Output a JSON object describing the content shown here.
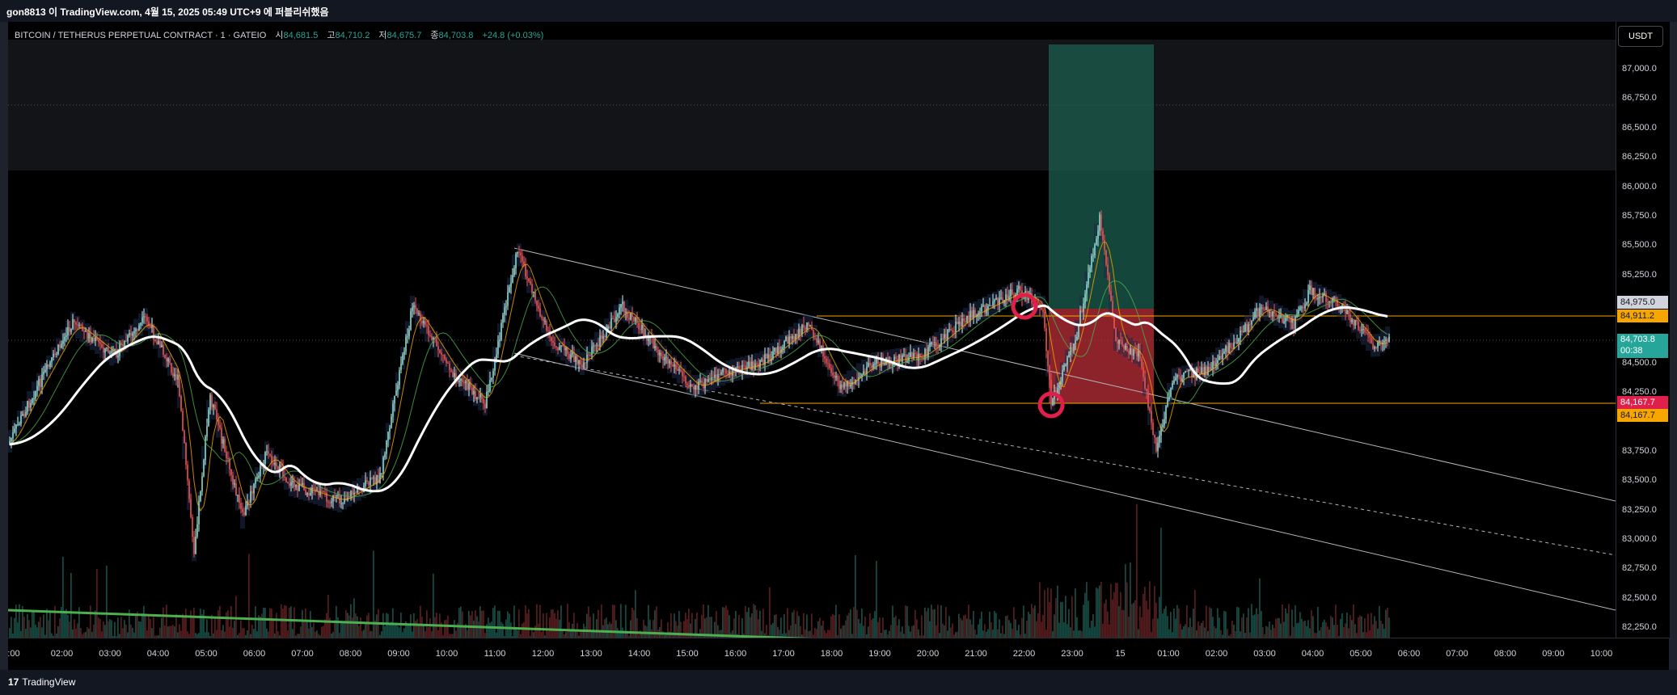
{
  "header": {
    "publish_text": "gon8813 이 TradingView.com, 4월 15, 2025 05:49 UTC+9 에 퍼블리쉬했음"
  },
  "legend": {
    "symbol": "BITCOIN / TETHERUS PERPETUAL CONTRACT · 1 · GATEIO",
    "open_label": "시",
    "open_value": "84,681.5",
    "high_label": "고",
    "high_value": "84,710.2",
    "low_label": "저",
    "low_value": "84,675.7",
    "close_label": "종",
    "close_value": "84,703.8",
    "change": "+24.8 (+0.03%)"
  },
  "currency_button": "USDT",
  "price_axis": {
    "ticks": [
      "87,000.0",
      "86,750.0",
      "86,500.0",
      "86,250.0",
      "86,000.0",
      "85,750.0",
      "85,500.0",
      "85,250.0",
      "84,500.0",
      "84,250.0",
      "83,750.0",
      "83,500.0",
      "83,250.0",
      "83,000.0",
      "82,750.0",
      "82,500.0",
      "82,250.0"
    ],
    "tags": {
      "upper_level": "84,975.0",
      "orange_upper": "84,911.2",
      "last_price": "84,703.8",
      "countdown": "00:38",
      "lower_level_red": "84,167.7",
      "lower_level_orange": "84,167.7"
    }
  },
  "time_axis": {
    "ticks": [
      ":00",
      "02:00",
      "03:00",
      "04:00",
      "05:00",
      "06:00",
      "07:00",
      "08:00",
      "09:00",
      "10:00",
      "11:00",
      "12:00",
      "13:00",
      "14:00",
      "15:00",
      "16:00",
      "17:00",
      "18:00",
      "19:00",
      "20:00",
      "21:00",
      "22:00",
      "23:00",
      "15",
      "01:00",
      "02:00",
      "03:00",
      "04:00",
      "05:00",
      "06:00",
      "07:00",
      "08:00",
      "09:00",
      "10:00"
    ]
  },
  "footer": {
    "brand": "TradingView"
  },
  "colors": {
    "up": "#26a69a",
    "down": "#ef5350",
    "ma_main": "#ffffff",
    "level_orange": "#f7a600",
    "trend_green": "#4caf50",
    "marker_red": "#e0204a",
    "channel": "#b2b5be"
  }
}
